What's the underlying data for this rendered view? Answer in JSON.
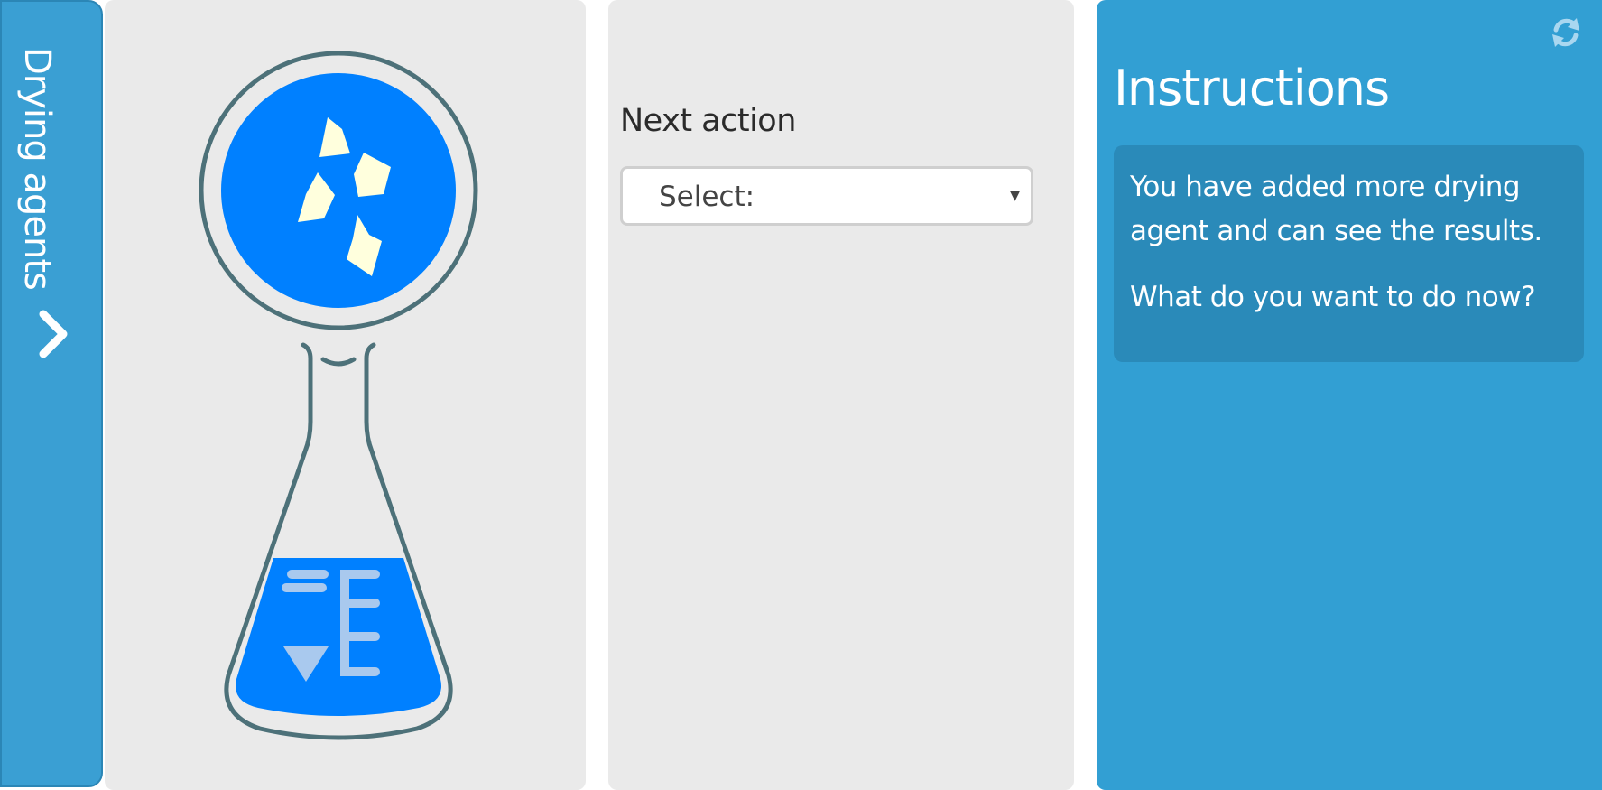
{
  "sidebar": {
    "tab_label": "Drying agents",
    "tab_icon": "chevron-right-icon"
  },
  "flask": {
    "flask_color": "#4d7179",
    "liquid_color": "#0080ff",
    "crystal_color": "#ffffdd",
    "icon": "erlenmeyer-flask-icon"
  },
  "action": {
    "heading": "Next action",
    "select_value": "Select:",
    "caret": "▾"
  },
  "instructions": {
    "title": "Instructions",
    "paragraph_1": "You have added more drying agent and can see the results.",
    "paragraph_2": "What do you want to do now?",
    "refresh_icon": "refresh-icon"
  },
  "colors": {
    "accent": "#329fd3",
    "panel_bg": "#eaeaea",
    "instructions_box": "#2a8ab9"
  }
}
